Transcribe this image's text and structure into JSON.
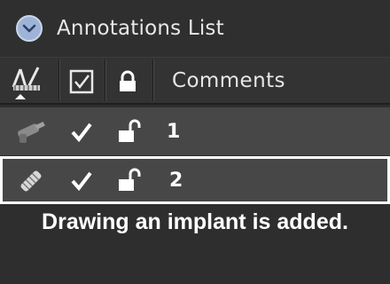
{
  "panel": {
    "title": "Annotations List",
    "collapse_icon": "chevron-down-icon"
  },
  "columns": {
    "tool_icon": "annotation-tool-icon",
    "visible_icon": "checkbox-checked-icon",
    "lock_icon": "lock-icon",
    "comments_label": "Comments"
  },
  "rows": [
    {
      "tool_icon": "drill-icon",
      "visible": true,
      "locked": false,
      "comment": "1",
      "selected": false
    },
    {
      "tool_icon": "implant-icon",
      "visible": true,
      "locked": false,
      "comment": "2",
      "selected": true
    }
  ],
  "status": {
    "message": "Drawing an implant is added."
  },
  "colors": {
    "background": "#2e2e2e",
    "row_background": "#474747",
    "selected_border": "#ffffff",
    "accent_button": "#9db4d8"
  }
}
